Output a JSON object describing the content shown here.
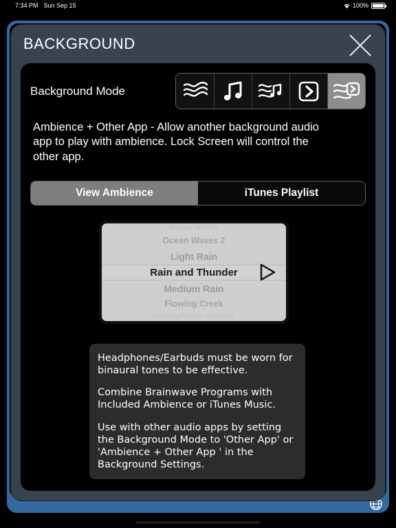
{
  "status_bar": {
    "time": "7:34 PM",
    "date": "Sun Sep 15",
    "wifi_icon": "wifi-icon",
    "battery_percent": "100%",
    "battery_icon": "battery-full-icon"
  },
  "modal": {
    "title": "BACKGROUND",
    "close_icon": "close-icon"
  },
  "background_mode": {
    "label": "Background Mode",
    "selected_index": 4,
    "options": [
      {
        "icon": "ambience-waves-icon",
        "name": "Ambience",
        "selected": false
      },
      {
        "icon": "music-note-icon",
        "name": "iTunes Music",
        "selected": false
      },
      {
        "icon": "ambience-music-icon",
        "name": "Ambience + Music",
        "selected": false
      },
      {
        "icon": "other-app-arrow-icon",
        "name": "Other App",
        "selected": false
      },
      {
        "icon": "ambience-other-app-icon",
        "name": "Ambience + Other App",
        "selected": true
      }
    ],
    "description": "Ambience + Other App - Allow another background audio app to play with ambience. Lock Screen will control the other app."
  },
  "view_toggle": {
    "selected": "View Ambience",
    "buttons": [
      {
        "label": "View Ambience",
        "selected": true
      },
      {
        "label": "iTunes Playlist",
        "selected": false
      }
    ]
  },
  "picker": {
    "selected": "Rain and Thunder",
    "play_icon": "play-triangle-icon",
    "items": [
      "Ocean Waves",
      "Ocean Waves 2",
      "Light Rain",
      "Rain and Thunder",
      "Medium Rain",
      "Flowing Creek",
      "Atmospheres: Serenity"
    ]
  },
  "info_panel": {
    "paragraphs": [
      "Headphones/Earbuds must be worn for binaural tones to be effective.",
      "Combine Brainwave Programs with Included Ambience or iTunes Music.",
      "Use with other audio apps by setting the Background Mode to 'Other App' or 'Ambience + Other App ' in the Background Settings."
    ]
  },
  "bottom_bar": {
    "globe_icon": "globe-icon",
    "color": "#35689e"
  },
  "colors": {
    "modal_header": "#39434f",
    "content_bg": "#000000",
    "selected_segment": "#8d8d8d",
    "picker_bg": "#cfcfcf",
    "info_bg": "#2c2c2c",
    "accent_blue": "#35689e"
  }
}
